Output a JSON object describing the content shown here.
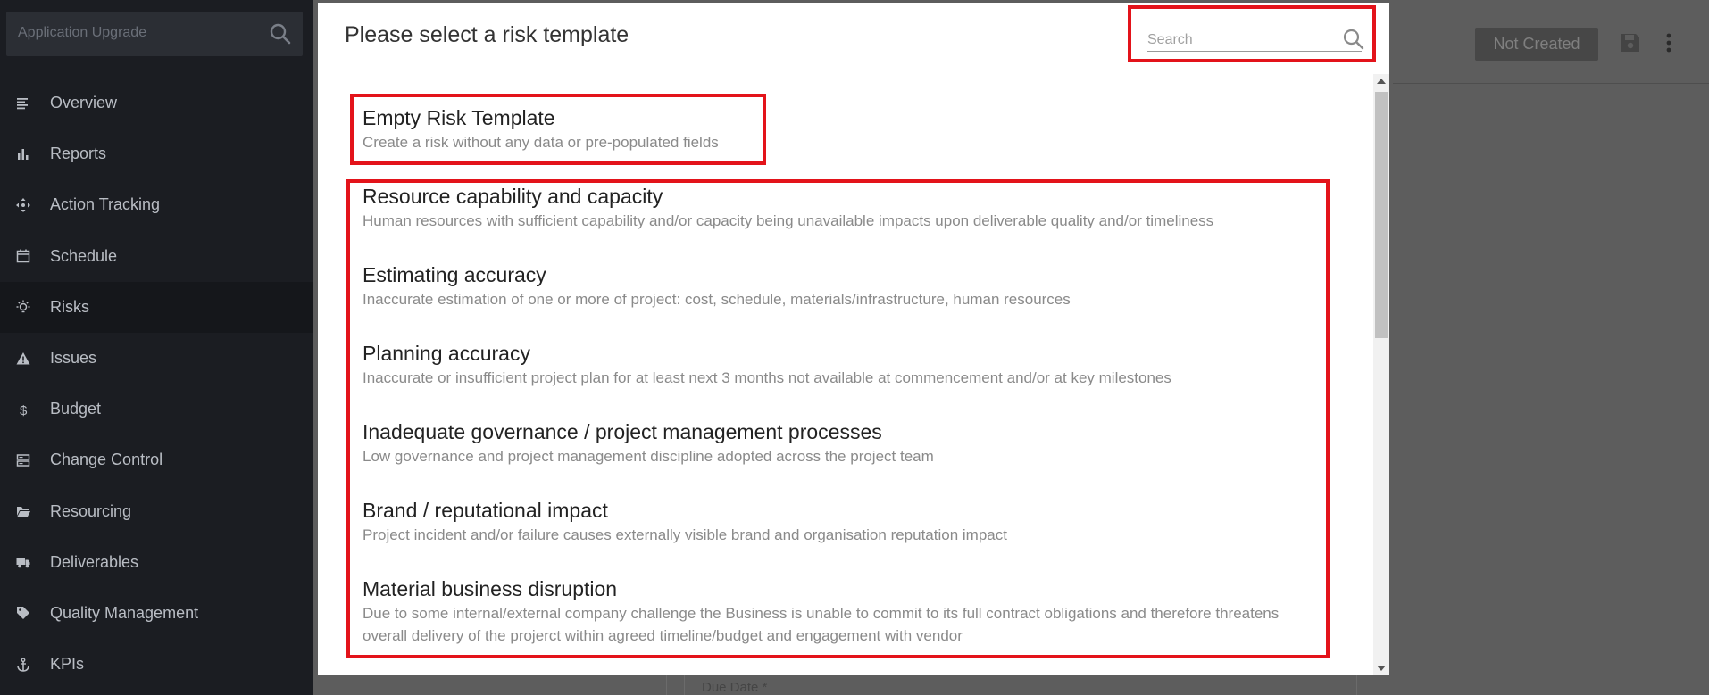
{
  "sidebar": {
    "search_placeholder": "Application Upgrade",
    "items": [
      {
        "label": "Overview",
        "icon": "list-icon"
      },
      {
        "label": "Reports",
        "icon": "bar-chart-icon"
      },
      {
        "label": "Action Tracking",
        "icon": "move-arrows-icon"
      },
      {
        "label": "Schedule",
        "icon": "calendar-icon"
      },
      {
        "label": "Risks",
        "icon": "lightbulb-icon",
        "active": true
      },
      {
        "label": "Issues",
        "icon": "warning-triangle-icon"
      },
      {
        "label": "Budget",
        "icon": "dollar-icon"
      },
      {
        "label": "Change Control",
        "icon": "server-icon"
      },
      {
        "label": "Resourcing",
        "icon": "folder-open-icon"
      },
      {
        "label": "Deliverables",
        "icon": "truck-icon"
      },
      {
        "label": "Quality Management",
        "icon": "tag-icon"
      },
      {
        "label": "KPIs",
        "icon": "anchor-icon"
      }
    ]
  },
  "header": {
    "status_label": "Not Created"
  },
  "background_form": {
    "due_date_label": "Due Date *"
  },
  "modal": {
    "title": "Please select a risk template",
    "search_placeholder": "Search",
    "empty_template": {
      "title": "Empty Risk Template",
      "description": "Create a risk without any data or pre-populated fields"
    },
    "templates": [
      {
        "title": "Resource capability and capacity",
        "description": "Human resources with sufficient capability and/or capacity being unavailable impacts upon deliverable quality and/or timeliness"
      },
      {
        "title": "Estimating accuracy",
        "description": "Inaccurate estimation of one or more of project: cost, schedule, materials/infrastructure, human resources"
      },
      {
        "title": "Planning accuracy",
        "description": "Inaccurate or insufficient project plan for at least next 3 months not available at commencement and/or at key milestones"
      },
      {
        "title": "Inadequate governance / project management processes",
        "description": "Low governance and project management discipline adopted across the project team"
      },
      {
        "title": "Brand / reputational impact",
        "description": "Project incident and/or failure causes externally visible brand and organisation reputation impact"
      },
      {
        "title": "Material business disruption",
        "description": "Due to some internal/external company challenge the Business is unable to commit to its full contract obligations and therefore threatens overall delivery of the projerct within agreed timeline/budget and engagement with vendor"
      }
    ]
  },
  "colors": {
    "highlight": "#e3131a",
    "sidebar_bg": "#1b1d22",
    "overlay": "#5d5d5d"
  }
}
